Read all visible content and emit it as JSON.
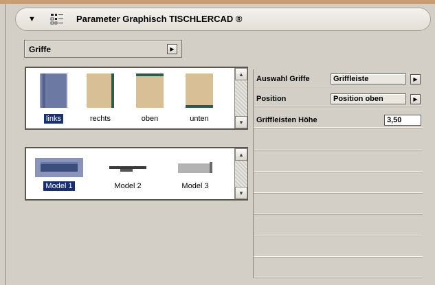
{
  "header": {
    "disclosure_glyph": "▼",
    "title": "Parameter Graphisch TISCHLERCAD ®",
    "icon": "settings-grid-icon"
  },
  "griffe_dropdown": {
    "selected": "Griffe",
    "arrow": "▶"
  },
  "position_thumbs": {
    "items": [
      {
        "label": "links",
        "selected": true
      },
      {
        "label": "rechts",
        "selected": false
      },
      {
        "label": "oben",
        "selected": false
      },
      {
        "label": "unten",
        "selected": false
      }
    ]
  },
  "model_thumbs": {
    "items": [
      {
        "label": "Model 1",
        "selected": true
      },
      {
        "label": "Model 2",
        "selected": false
      },
      {
        "label": "Model 3",
        "selected": false
      }
    ]
  },
  "scroll": {
    "up": "▲",
    "down": "▼"
  },
  "properties": {
    "rows": [
      {
        "label": "Auswahl Griffe",
        "value": "Griffleiste",
        "arrow": "▶"
      },
      {
        "label": "Position",
        "value": "Position oben",
        "arrow": "▶"
      },
      {
        "label": "Griffleisten Höhe",
        "value": "3,50"
      }
    ]
  },
  "colors": {
    "selection": "#1a2f6b",
    "wood": "#d9bf95",
    "panel_bg": "#d4cfc6"
  }
}
